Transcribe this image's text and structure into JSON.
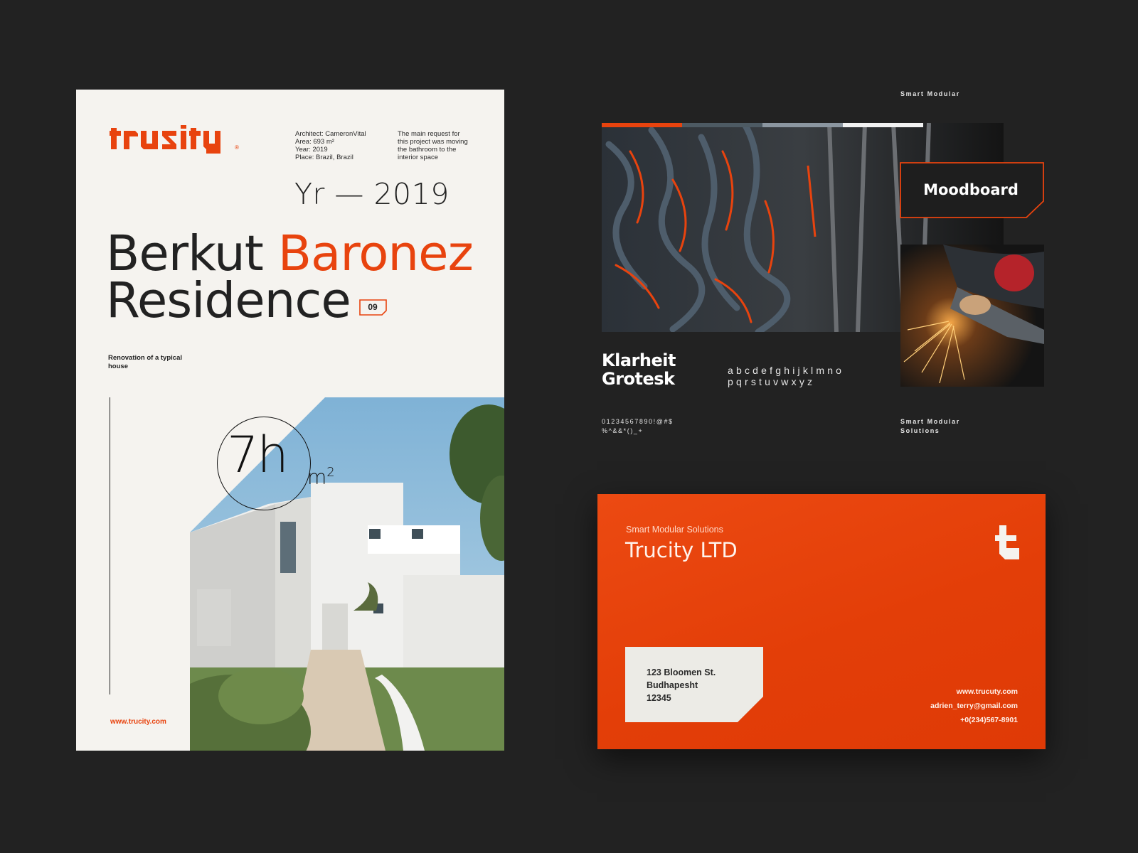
{
  "poster": {
    "logo_text": "trucity",
    "meta_left": "Architect: CameronVital\nArea: 693 m²\nYear: 2019\nPlace: Brazil, Brazil",
    "meta_right": "The main request for\nthis project was moving\nthe bathroom to the\ninterior space",
    "year": "Yr — 2019",
    "title_part1": "Berkut ",
    "title_accent": "Baronez",
    "title_part2": "Residence",
    "badge": "09",
    "subtitle": "Renovation of a typical house",
    "area_value": "7h",
    "area_unit": "m",
    "area_unit_sup": "2",
    "url": "www.trucity.com"
  },
  "moodboard": {
    "top_label": "Smart Modular",
    "tag": "Moodboard",
    "font_name": "Klarheit\nGrotesk",
    "alphabet": "abcdefghijklmno\npqrstuvwxyz",
    "numbers": "01234567890!@#$\n%^&&*()_+",
    "bottom_label": "Smart Modular\nSolutions",
    "strip_colors": [
      "#e8430e",
      "#4d5a63",
      "#8b96a0",
      "#f2f2f2"
    ]
  },
  "envelope": {
    "tagline": "Smart Modular Solutions",
    "company": "Trucity LTD",
    "address": "123 Bloomen St.\nBudhapesht\n12345",
    "website": "www.trucuty.com",
    "email": "adrien_terry@gmail.com",
    "phone": "+0(234)567-8901"
  },
  "colors": {
    "accent": "#e8430e",
    "background": "#222222",
    "paper": "#f5f3ef"
  }
}
